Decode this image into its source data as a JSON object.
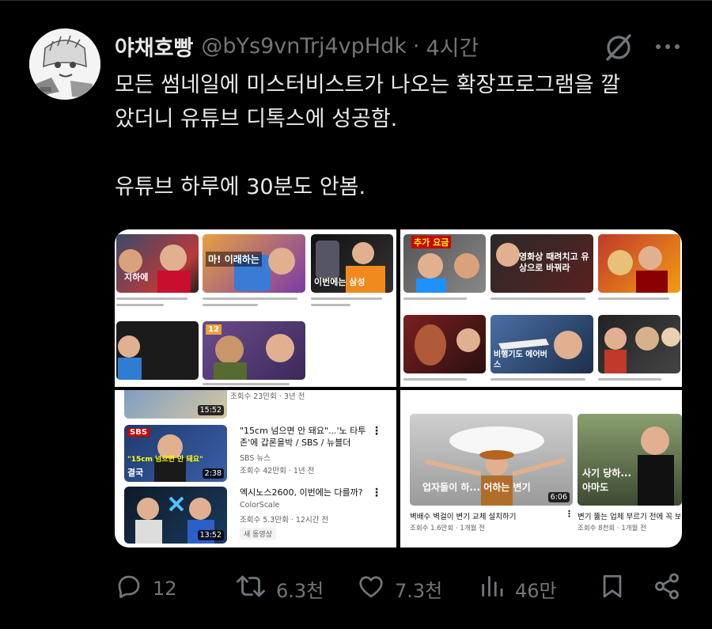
{
  "tweet": {
    "author_name": "야채호빵",
    "handle": "@bYs9vnTrj4vpHdk",
    "separator": "·",
    "time": "4시간",
    "text_line1": "모든 썸네일에 미스터비스트가 나오는 확장프로그램을 깔",
    "text_line2": "았더니 유튜브 디톡스에 성공함.",
    "text_line3": "유튜브 하루에 30분도 안봄."
  },
  "media": {
    "panel_top_left": {
      "thumbs": [
        "지하에",
        "마! 이래하는",
        "이번에는 삼성"
      ],
      "icon_badge": "12"
    },
    "panel_top_right": {
      "thumbs": [
        "추가 요금",
        "영화상 때려치고 유상으로 바꿔라",
        "비행기도 에어버스"
      ]
    },
    "panel_bottom_left": {
      "top_meta": "조회수 23만회 · 3년 전",
      "top_duration": "15:52",
      "rows": [
        {
          "title": "\"15cm 넘으면 안 돼요\"...'노 타투 존'에 갑론을박 / SBS / 뉴블더",
          "channel": "SBS 뉴스",
          "meta": "조회수 42만회 · 1년 전",
          "duration": "2:38",
          "thumb_text": "SBS",
          "thumb_caption": "\"15cm 넘으면 안 돼요\"",
          "thumb_word": "결국"
        },
        {
          "title": "엑시노스2600, 이번에는 다를까?",
          "channel": "ColorScale",
          "meta": "조회수 5.3만회 · 12시간 전",
          "badge": "새 동영상",
          "duration": "13:52"
        }
      ]
    },
    "panel_bottom_right": {
      "videos": [
        {
          "caption": "업자들이 하... 어하는 변기",
          "duration": "6:06",
          "title": "벽배수 벽걸이 변기 교체 설치하기",
          "meta": "조회수 1.6만회 · 1개월 전"
        },
        {
          "caption": "사기 당하... 아마도",
          "title": "변기 뚫는 업체 부르기 전에 꼭 보세요!",
          "meta": "조회수 8천회 · 1개월 전"
        }
      ]
    }
  },
  "actions": {
    "replies": "12",
    "reposts": "6.3천",
    "likes": "7.3천",
    "views": "46만"
  },
  "colors": {
    "background": "#000000",
    "text_primary": "#e7e9ea",
    "text_secondary": "#71767b"
  },
  "icons": [
    "reply-icon",
    "repost-icon",
    "like-icon",
    "views-icon",
    "bookmark-icon",
    "share-icon",
    "grok-icon",
    "more-icon"
  ]
}
